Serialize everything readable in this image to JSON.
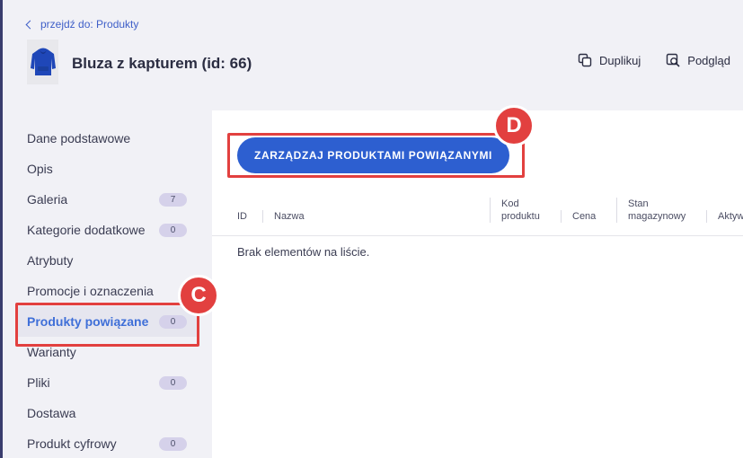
{
  "header": {
    "breadcrumb": "przejdź do: Produkty",
    "title": "Bluza z kapturem (id: 66)",
    "actions": [
      {
        "label": "Duplikuj",
        "icon": "duplicate-icon"
      },
      {
        "label": "Podgląd",
        "icon": "preview-icon"
      }
    ]
  },
  "sidebar": {
    "items": [
      {
        "label": "Dane podstawowe"
      },
      {
        "label": "Opis"
      },
      {
        "label": "Galeria",
        "count": "7"
      },
      {
        "label": "Kategorie dodatkowe",
        "count": "0"
      },
      {
        "label": "Atrybuty"
      },
      {
        "label": "Promocje i oznaczenia"
      },
      {
        "label": "Produkty powiązane",
        "count": "0",
        "active": true
      },
      {
        "label": "Warianty"
      },
      {
        "label": "Pliki",
        "count": "0"
      },
      {
        "label": "Dostawa"
      },
      {
        "label": "Produkt cyfrowy",
        "count": "0"
      }
    ]
  },
  "main": {
    "manage_button": "ZARZĄDZAJ PRODUKTAMI POWIĄZANYMI",
    "table": {
      "columns": [
        "ID",
        "Nazwa",
        "Kod\nproduktu",
        "Cena",
        "Stan\nmagazynowy",
        "Aktyw"
      ]
    },
    "empty_message": "Brak elementów na liście."
  },
  "annotations": {
    "c_label": "C",
    "d_label": "D"
  },
  "colors": {
    "accent": "#2d5fd0",
    "annotation": "#e2403f",
    "active_text": "#3f6fd8"
  }
}
